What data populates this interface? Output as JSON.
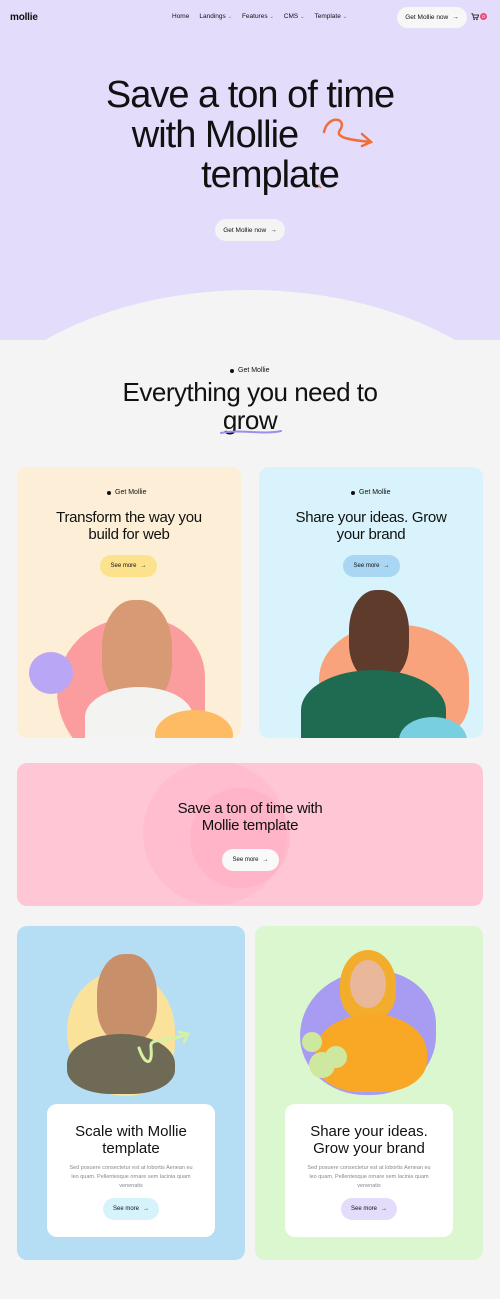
{
  "nav": {
    "logo": "mollie",
    "links": [
      {
        "label": "Home",
        "dropdown": false
      },
      {
        "label": "Landings",
        "dropdown": true
      },
      {
        "label": "Features",
        "dropdown": true
      },
      {
        "label": "CMS",
        "dropdown": true
      },
      {
        "label": "Template",
        "dropdown": true
      }
    ],
    "cta": "Get Mollie now",
    "cart_icon": "cart-icon",
    "cart_count": "0"
  },
  "hero": {
    "title_lines": [
      "Save a ton of time",
      "with Mollie",
      "template"
    ],
    "cta": "Get Mollie now",
    "bg": "#e3dcfb"
  },
  "features": {
    "eyebrow": "Get Mollie",
    "title_line1": "Everything you need to",
    "title_line2": "grow"
  },
  "cards": [
    {
      "eyebrow": "Get Mollie",
      "title": "Transform the way you build for web",
      "button": "See more",
      "bg": "#fdeed7",
      "button_bg": "#fde28e"
    },
    {
      "eyebrow": "Get Mollie",
      "title": "Share your ideas. Grow your brand",
      "button": "See more",
      "bg": "#d8f3fb",
      "button_bg": "#a9d6f2"
    }
  ],
  "banner": {
    "title": "Save a ton of time with Mollie template",
    "button": "See more",
    "bg": "#ffc6d6"
  },
  "bottom_cards": [
    {
      "title": "Scale with Mollie template",
      "desc": "Sed posuere consectetur est at lobortis Aenean eu leo quam. Pellentesque ornare sem lacinia quam venenatis",
      "button": "See more",
      "bg": "#b5def4",
      "button_bg": "#d6f3fb"
    },
    {
      "title": "Share your ideas. Grow your brand",
      "desc": "Sed posuere consectetur est at lobortis Aenean eu leo quam. Pellentesque ornare sem lacinia quam venenatis",
      "button": "See more",
      "bg": "#dbf7cf",
      "button_bg": "#e4dcfb"
    }
  ],
  "arrow": "→"
}
